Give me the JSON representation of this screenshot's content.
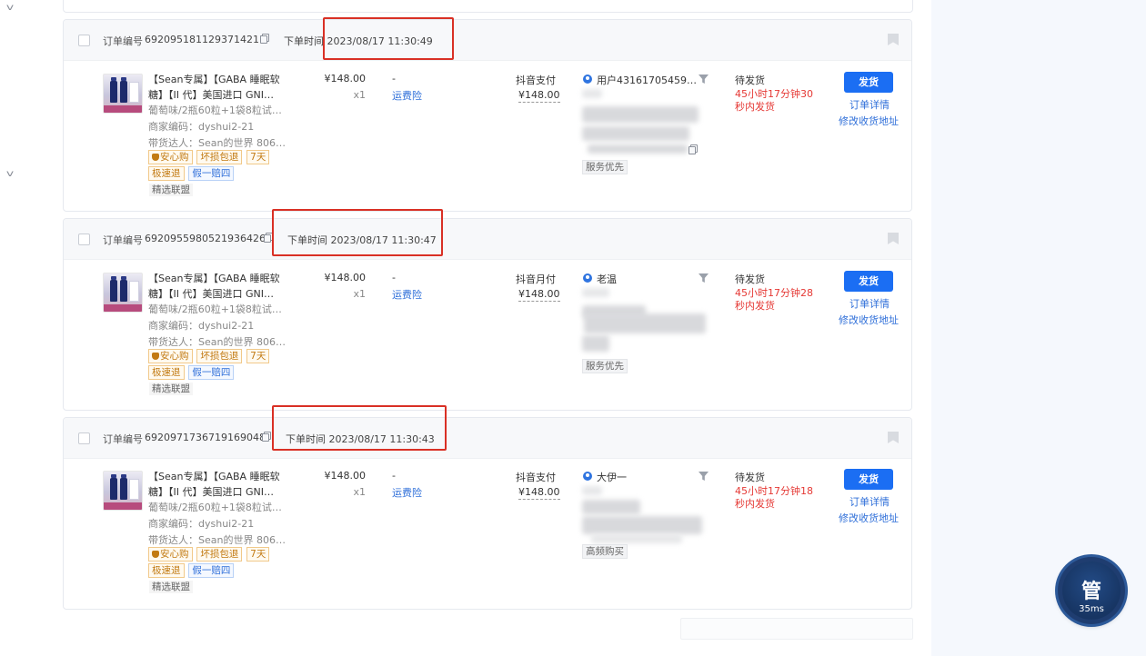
{
  "orders": [
    {
      "order_no_label": "订单编号",
      "order_no": "6920951811293714211",
      "order_time": "下单时间 2023/08/17 11:30:49",
      "product_title_1": "【Sean专属】【GABA 睡眠软",
      "product_title_2": "糖】【II 代】美国进口 GNI…",
      "sku": "葡萄味/2瓶60粒+1袋8粒试…",
      "merchant_code": "商家编码：dyshui2-21",
      "influencer": "带货达人：Sean的世界 806…",
      "tags": [
        "安心购",
        "坏损包退",
        "7天",
        "极速退",
        "假一赔四",
        "精选联盟"
      ],
      "price": "¥148.00",
      "qty": "x1",
      "dash": "-",
      "freight_label": "运费险",
      "pay_method": "抖音支付",
      "pay_amount": "¥148.00",
      "buyer_name": "用户43161705459…",
      "service_tag": "服务优先",
      "status": "待发货",
      "countdown": "45小时17分钟30秒内发货",
      "ship_label": "发货",
      "detail_label": "订单详情",
      "edit_addr_label": "修改收货地址"
    },
    {
      "order_no_label": "订单编号",
      "order_no": "6920955980521936426",
      "order_time": "下单时间 2023/08/17 11:30:47",
      "product_title_1": "【Sean专属】【GABA 睡眠软",
      "product_title_2": "糖】【II 代】美国进口 GNI…",
      "sku": "葡萄味/2瓶60粒+1袋8粒试…",
      "merchant_code": "商家编码：dyshui2-21",
      "influencer": "带货达人：Sean的世界 806…",
      "tags": [
        "安心购",
        "坏损包退",
        "7天",
        "极速退",
        "假一赔四",
        "精选联盟"
      ],
      "price": "¥148.00",
      "qty": "x1",
      "dash": "-",
      "freight_label": "运费险",
      "pay_method": "抖音月付",
      "pay_amount": "¥148.00",
      "buyer_name": "老温",
      "service_tag": "服务优先",
      "status": "待发货",
      "countdown": "45小时17分钟28秒内发货",
      "ship_label": "发货",
      "detail_label": "订单详情",
      "edit_addr_label": "修改收货地址"
    },
    {
      "order_no_label": "订单编号",
      "order_no": "6920971736719169048",
      "order_time": "下单时间 2023/08/17 11:30:43",
      "product_title_1": "【Sean专属】【GABA 睡眠软",
      "product_title_2": "糖】【II 代】美国进口 GNI…",
      "sku": "葡萄味/2瓶60粒+1袋8粒试…",
      "merchant_code": "商家编码：dyshui2-21",
      "influencer": "带货达人：Sean的世界 806…",
      "tags": [
        "安心购",
        "坏损包退",
        "7天",
        "极速退",
        "假一赔四",
        "精选联盟"
      ],
      "price": "¥148.00",
      "qty": "x1",
      "dash": "-",
      "freight_label": "运费险",
      "pay_method": "抖音支付",
      "pay_amount": "¥148.00",
      "buyer_name": "大伊一",
      "service_tag": "高频购买",
      "status": "待发货",
      "countdown": "45小时17分钟18秒内发货",
      "ship_label": "发货",
      "detail_label": "订单详情",
      "edit_addr_label": "修改收货地址"
    }
  ],
  "floating_badge": {
    "char": "管",
    "latency": "35ms"
  },
  "colors": {
    "primary": "#1b6ef3",
    "countdown_red": "#e53935",
    "highlight_red": "#d93025",
    "link_blue": "#2f6fd9"
  }
}
